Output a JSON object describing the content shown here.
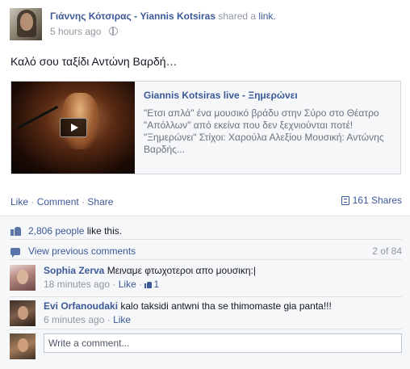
{
  "post": {
    "author": "Γιάννης Κότσιρας - Yiannis Kotsiras",
    "action_text": "shared a",
    "action_link": "link.",
    "timestamp": "5 hours ago",
    "message": "Καλό σου ταξίδι Αντώνη Βαρδή…"
  },
  "link_card": {
    "title": "Giannis Kotsiras live - Ξημερώνει",
    "description": "\"Ετσι απλά\" ένα μουσικό βράδυ στην Σύρο στο Θέατρο \"Απόλλων\" από εκείνα που δεν ξεχνιούνται ποτέ! \"Ξημερώνει\" Στίχοι: Χαρούλα Αλεξίου Μουσική: Αντώνης Βαρδής..."
  },
  "actions": {
    "like": "Like",
    "comment": "Comment",
    "share": "Share",
    "separator": "·",
    "shares_count": "161 Shares"
  },
  "ufi": {
    "likes_count": "2,806 people",
    "likes_suffix": " like this.",
    "view_previous": "View previous comments",
    "comment_count": "2 of 84",
    "comments": [
      {
        "author": "Sophia Zerva",
        "text": "Μειναμε φτωχοτεροι απο μουσικη:|",
        "time": "18 minutes ago",
        "like_label": "Like",
        "likes": "1"
      },
      {
        "author": "Evi Orfanoudaki",
        "text": "kalo taksidi antwni tha se thimomaste gia panta!!!",
        "time": "6 minutes ago",
        "like_label": "Like"
      }
    ],
    "write_placeholder": "Write a comment..."
  },
  "colors": {
    "link_blue": "#3b5998",
    "muted_gray": "#9197a3",
    "ufi_background": "#f6f7f9"
  }
}
